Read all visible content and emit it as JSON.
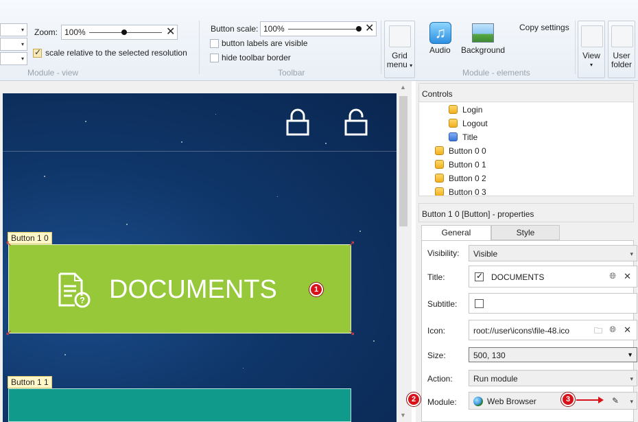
{
  "ribbon": {
    "module_view": {
      "zoom_label": "Zoom:",
      "zoom_value": "100%",
      "scale_relative_label": "scale relative to the selected resolution",
      "scale_relative_checked": true,
      "group_label": "Module - view"
    },
    "toolbar": {
      "button_scale_label": "Button scale:",
      "button_scale_value": "100%",
      "labels_visible_label": "button labels are visible",
      "labels_visible_checked": false,
      "hide_border_label": "hide toolbar border",
      "hide_border_checked": false,
      "group_label": "Toolbar"
    },
    "grid_menu_label_1": "Grid",
    "grid_menu_label_2": "menu",
    "elements": {
      "audio_label": "Audio",
      "background_label": "Background",
      "copy_settings_label": "Copy settings",
      "group_label": "Module - elements"
    },
    "view_label": "View",
    "user_folder_label_1": "User",
    "user_folder_label_2": "folder"
  },
  "canvas": {
    "button_1_0_tag": "Button 1 0",
    "button_1_0_title": "DOCUMENTS",
    "button_1_0_color": "#96c83a",
    "button_1_1_tag": "Button 1 1",
    "button_1_1_color": "#0f9a8c",
    "badge_1": "1"
  },
  "controls": {
    "title": "Controls",
    "nodes": [
      {
        "label": "Login",
        "icon": "folder-yellow"
      },
      {
        "label": "Logout",
        "icon": "folder-yellow"
      },
      {
        "label": "Title",
        "icon": "folder-blue"
      },
      {
        "label": "Button 0 0",
        "icon": "folder-yellow"
      },
      {
        "label": "Button 0 1",
        "icon": "folder-yellow"
      },
      {
        "label": "Button 0 2",
        "icon": "folder-yellow"
      },
      {
        "label": "Button 0 3",
        "icon": "folder-yellow"
      }
    ]
  },
  "properties": {
    "title": "Button 1 0 [Button] - properties",
    "tabs": [
      "General",
      "Style"
    ],
    "visibility_label": "Visibility:",
    "visibility_value": "Visible",
    "title_label": "Title:",
    "title_value": "DOCUMENTS",
    "title_checked": true,
    "subtitle_label": "Subtitle:",
    "subtitle_checked": false,
    "icon_label": "Icon:",
    "icon_value": "root://user\\icons\\file-48.ico",
    "size_label": "Size:",
    "size_value": "500, 130",
    "action_label": "Action:",
    "action_value": "Run module",
    "module_label": "Module:",
    "module_value": "Web Browser",
    "badge_2": "2",
    "badge_3": "3"
  }
}
